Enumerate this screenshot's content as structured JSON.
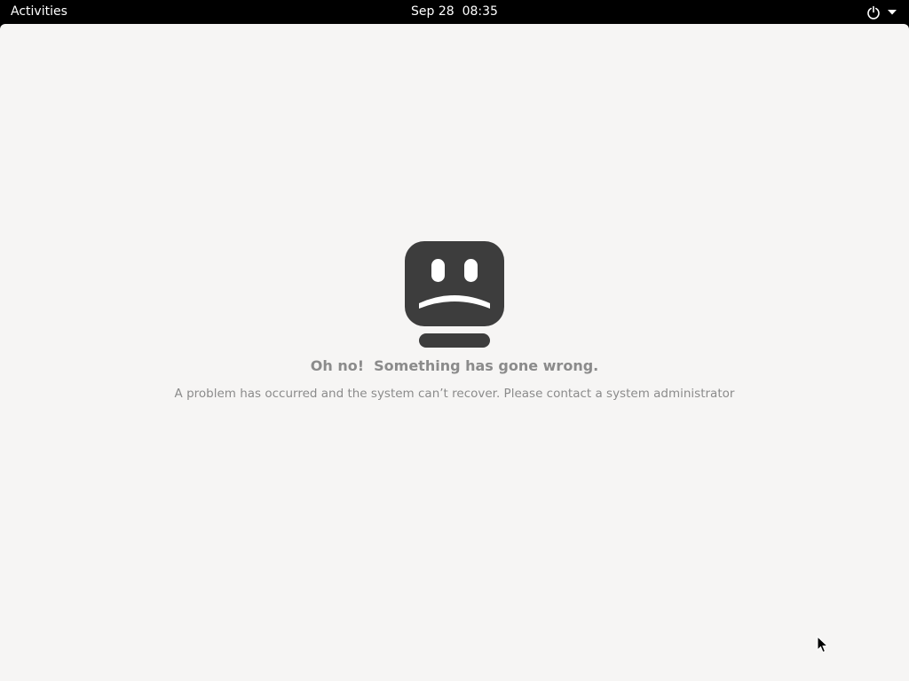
{
  "topbar": {
    "activities_label": "Activities",
    "clock": "Sep 28  08:35",
    "power_icon": "power-icon",
    "menu_arrow_icon": "chevron-down-icon"
  },
  "error_screen": {
    "icon": "sad-computer-icon",
    "title": "Oh no!  Something has gone wrong.",
    "message": "A problem has occurred and the system can’t recover. Please contact a system administrator"
  },
  "colors": {
    "topbar_bg": "#000000",
    "desktop_bg": "#f6f5f4",
    "icon_fill": "#3d3d3d",
    "text_muted": "#8b8b8b"
  }
}
